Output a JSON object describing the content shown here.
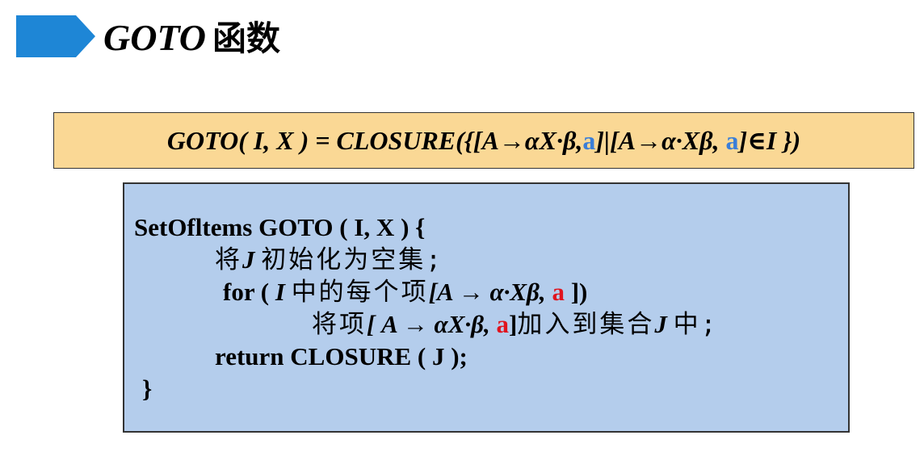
{
  "slide": {
    "title_italic": "GOTO",
    "title_cjk": "函数"
  },
  "formula": {
    "p1": "GOTO( I, X ) = CLOSURE({[A→αX·β,",
    "a1": "a",
    "p2": "]|[A→α·Xβ, ",
    "a2": "a",
    "p3": "]∈I })"
  },
  "code": {
    "line1": "SetOfltems GOTO ( I,  X ) {",
    "line2_cjk1": "将",
    "line2_var": "J",
    "line2_cjk2": "初始化为空集;",
    "line3_for": "for ( ",
    "line3_var": "I",
    "line3_cjk": "中的每个项",
    "line3_item": "[A → α·Xβ,  ",
    "line3_a": "a",
    "line3_end": " ])",
    "line4_cjk1": "将项",
    "line4_item": "[ A → αX·β,  ",
    "line4_a": "a",
    "line4_bracket": "]",
    "line4_cjk2": "加入到集合",
    "line4_var": "J",
    "line4_cjk3": "中;",
    "line5": "return CLOSURE ( J );",
    "line6": "}"
  },
  "colors": {
    "title_arrow": "#1e86d6",
    "formula_bg": "#fad895",
    "code_bg": "#b4cdec",
    "blue_a": "#3a7ed8",
    "red_a": "#e0141e"
  }
}
